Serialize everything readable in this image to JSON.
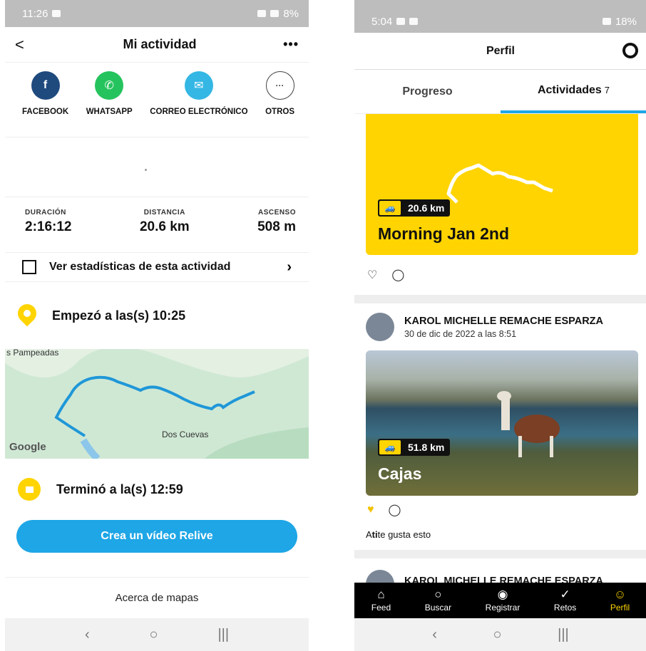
{
  "left": {
    "status": {
      "time": "11:26",
      "battery": "8%"
    },
    "header": {
      "back": "<",
      "title": "Mi actividad",
      "more": "•••"
    },
    "share": [
      {
        "label": "FACEBOOK",
        "glyph": "f"
      },
      {
        "label": "WHATSAPP",
        "glyph": "✆"
      },
      {
        "label": "CORREO ELECTRÓNICO",
        "glyph": "✉"
      },
      {
        "label": "OTROS",
        "glyph": "···"
      }
    ],
    "stats": [
      {
        "label": "DURACIÓN",
        "value": "2:16:12"
      },
      {
        "label": "DISTANCIA",
        "value": "20.6 km"
      },
      {
        "label": "ASCENSO",
        "value": "508 m"
      }
    ],
    "stats_link": "Ver estadísticas de esta actividad",
    "start": "Empezó a las(s) 10:25",
    "map": {
      "label1": "s Pampeadas",
      "label2": "Dos Cuevas",
      "brand": "Google"
    },
    "end": "Terminó a la(s) 12:59",
    "cta": "Crea un vídeo Relive",
    "about": "Acerca de mapas",
    "nav": [
      "‹",
      "○",
      "|||"
    ]
  },
  "right": {
    "status": {
      "time": "5:04",
      "battery": "18%"
    },
    "header": {
      "title": "Perfil"
    },
    "tabs": {
      "progress": "Progreso",
      "activities": "Actividades",
      "count": "7"
    },
    "card1": {
      "distance": "20.6 km",
      "name": "Morning Jan 2nd"
    },
    "post": {
      "author": "KAROL MICHELLE REMACHE ESPARZA",
      "date": "30 de dic de 2022 a las 8:51"
    },
    "card2": {
      "distance": "51.8 km",
      "name": "Cajas"
    },
    "likes_prefix": "A ",
    "likes_you": "ti",
    "likes_suffix": " te gusta esto",
    "post2_author": "KAROL MICHELLE REMACHE ESPARZA",
    "bottom_nav": [
      {
        "label": "Feed",
        "icon": "⌂"
      },
      {
        "label": "Buscar",
        "icon": "○"
      },
      {
        "label": "Registrar",
        "icon": "◉"
      },
      {
        "label": "Retos",
        "icon": "✓"
      },
      {
        "label": "Perfil",
        "icon": "☺"
      }
    ],
    "nav": [
      "‹",
      "○",
      "|||"
    ]
  },
  "colors": {
    "accent": "#ffd400",
    "blue": "#1ea6e6"
  }
}
